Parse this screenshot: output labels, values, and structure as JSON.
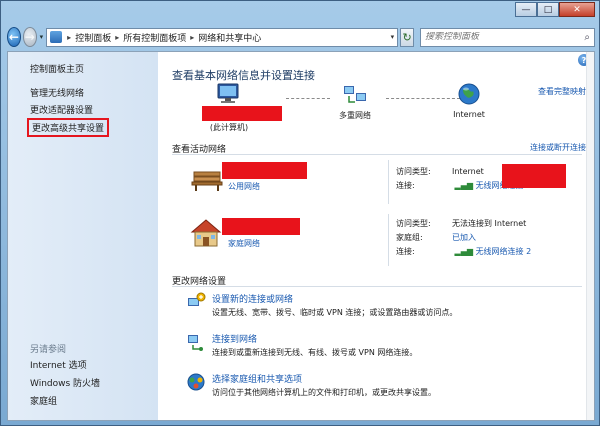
{
  "window": {
    "min_icon": "minimize-icon",
    "max_icon": "maximize-icon",
    "close_icon": "close-icon",
    "min_glyph": "—",
    "max_glyph": "□",
    "close_glyph": "✕"
  },
  "nav": {
    "back_glyph": "←",
    "forward_glyph": "→",
    "dropdown_glyph": "▾",
    "refresh_glyph": "↻"
  },
  "address": {
    "breadcrumbs": [
      "控制面板",
      "所有控制面板项",
      "网络和共享中心"
    ],
    "separator": "▸"
  },
  "search": {
    "placeholder": "搜索控制面板",
    "icon_glyph": "⌕"
  },
  "sidebar": {
    "title": "控制面板主页",
    "links": [
      "管理无线网络",
      "更改适配器设置",
      "更改高级共享设置"
    ],
    "see_also_title": "另请参阅",
    "see_also": [
      "Internet 选项",
      "Windows 防火墙",
      "家庭组"
    ]
  },
  "main": {
    "title": "查看基本网络信息并设置连接",
    "full_map_link": "查看完整映射",
    "help_glyph": "?",
    "map": {
      "computer_label": "(此计算机)",
      "network_label": "多重网络",
      "internet_label": "Internet"
    },
    "active_title": "查看活动网络",
    "connect_link": "连接或断开连接",
    "networks": [
      {
        "type_label": "公用网络",
        "rows": [
          {
            "k": "访问类型:",
            "v": "Internet"
          },
          {
            "k": "连接:",
            "v": "无线网络连接"
          }
        ]
      },
      {
        "type_label": "家庭网络",
        "rows": [
          {
            "k": "访问类型:",
            "v": "无法连接到 Internet"
          },
          {
            "k": "家庭组:",
            "v": "已加入"
          },
          {
            "k": "连接:",
            "v": "无线网络连接 2"
          }
        ]
      }
    ],
    "change_title": "更改网络设置",
    "tasks": [
      {
        "title": "设置新的连接或网络",
        "desc": "设置无线、宽带、拨号、临时或 VPN 连接；或设置路由器或访问点。"
      },
      {
        "title": "连接到网络",
        "desc": "连接到或重新连接到无线、有线、拨号或 VPN 网络连接。"
      },
      {
        "title": "选择家庭组和共享选项",
        "desc": "访问位于其他网络计算机上的文件和打印机，或更改共享设置。"
      }
    ]
  },
  "colors": {
    "link": "#1a5ab0",
    "redaction": "#e8131b",
    "highlight_box": "#e5161f"
  }
}
